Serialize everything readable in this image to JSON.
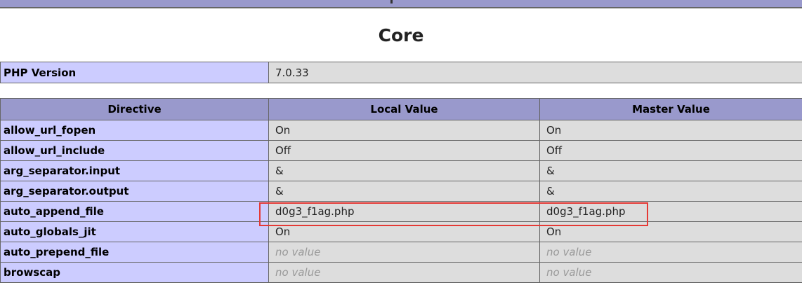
{
  "section": {
    "title": "Core"
  },
  "version_row": {
    "label": "PHP Version",
    "value": "7.0.33"
  },
  "headers": {
    "directive": "Directive",
    "local": "Local Value",
    "master": "Master Value"
  },
  "directives": [
    {
      "name": "allow_url_fopen",
      "local": "On",
      "master": "On"
    },
    {
      "name": "allow_url_include",
      "local": "Off",
      "master": "Off"
    },
    {
      "name": "arg_separator.input",
      "local": "&",
      "master": "&"
    },
    {
      "name": "arg_separator.output",
      "local": "&",
      "master": "&"
    },
    {
      "name": "auto_append_file",
      "local": "d0g3_f1ag.php",
      "master": "d0g3_f1ag.php"
    },
    {
      "name": "auto_globals_jit",
      "local": "On",
      "master": "On"
    },
    {
      "name": "auto_prepend_file",
      "local": "no value",
      "master": "no value"
    },
    {
      "name": "browscap",
      "local": "no value",
      "master": "no value"
    }
  ],
  "colors": {
    "header_bg": "#9999cc",
    "directive_bg": "#ccccff",
    "value_bg": "#dddddd",
    "highlight": "#e53935",
    "no_value_text": "#999999"
  }
}
